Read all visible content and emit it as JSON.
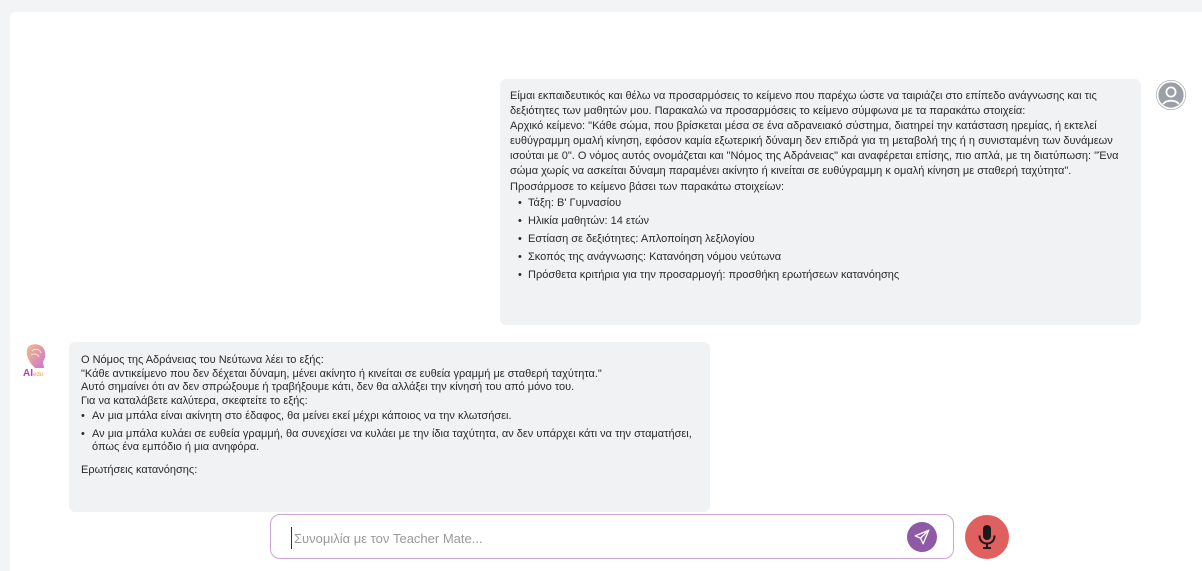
{
  "user_message": {
    "paragraphs": [
      "Είμαι εκπαιδευτικός και θέλω να προσαρμόσεις το κείμενο που παρέχω ώστε να ταιριάζει στο επίπεδο ανάγνωσης και τις δεξιότητες των μαθητών μου. Παρακαλώ να προσαρμόσεις το κείμενο σύμφωνα με τα παρακάτω στοιχεία:",
      "Αρχικό κείμενο: \"Κάθε σώμα, που βρίσκεται μέσα σε ένα αδρανειακό σύστημα, διατηρεί την κατάσταση ηρεμίας, ή εκτελεί ευθύγραμμη ομαλή κίνηση, εφόσον καμία εξωτερική δύναμη δεν επιδρά για τη μεταβολή της ή η συνισταμένη των δυνάμεων ισούται με 0\". Ο νόμος αυτός ονομάζεται και \"Νόμος της Αδράνειας\" και αναφέρεται επίσης, πιο απλά, με τη διατύπωση: \"Ένα σώμα χωρίς να ασκείται δύναμη παραμένει ακίνητο ή κινείται σε ευθύγραμμη κ ομαλή κίνηση με σταθερή ταχύτητα\".",
      "Προσάρμοσε το κείμενο βάσει των παρακάτω στοιχείων:"
    ],
    "items": [
      "Τάξη: Β' Γυμνασίου",
      "Ηλικία μαθητών: 14 ετών",
      "Εστίαση σε δεξιότητες: Απλοποίηση λεξιλογίου",
      "Σκοπός της ανάγνωσης: Κατανόηση νόμου νεύτωνα",
      "Πρόσθετα κριτήρια για την προσαρμογή: προσθήκη ερωτήσεων κατανόησης"
    ]
  },
  "ai_logo_text": "AI",
  "ai_logo_sub": "edu",
  "ai_message": {
    "lines": [
      "Ο Νόμος της Αδράνειας του Νεύτωνα λέει το εξής:",
      "\"Κάθε αντικείμενο που δεν δέχεται δύναμη, μένει ακίνητο ή κινείται σε ευθεία γραμμή με σταθερή ταχύτητα.\"",
      "Αυτό σημαίνει ότι αν δεν σπρώξουμε ή τραβήξουμε κάτι, δεν θα αλλάξει την κίνησή του από μόνο του.",
      "Για να καταλάβετε καλύτερα, σκεφτείτε το εξής:"
    ],
    "items": [
      "Αν μια μπάλα είναι ακίνητη στο έδαφος, θα μείνει εκεί μέχρι κάποιος να την κλωτσήσει.",
      "Αν μια μπάλα κυλάει σε ευθεία γραμμή, θα συνεχίσει να κυλάει με την ίδια ταχύτητα, αν δεν υπάρχει κάτι να την σταματήσει, όπως ένα εμπόδιο ή μια ανηφόρα."
    ],
    "questions_heading": "Ερωτήσεις κατανόησης:"
  },
  "input": {
    "placeholder": "Συνομιλία με τον Teacher Mate...",
    "value": ""
  },
  "icons": {
    "user_avatar": "user-circle-icon",
    "send": "paper-plane-icon",
    "mic": "microphone-icon"
  },
  "colors": {
    "accent": "#8e5aa5",
    "mic": "#e06060",
    "bubble": "#f1f2f4"
  }
}
